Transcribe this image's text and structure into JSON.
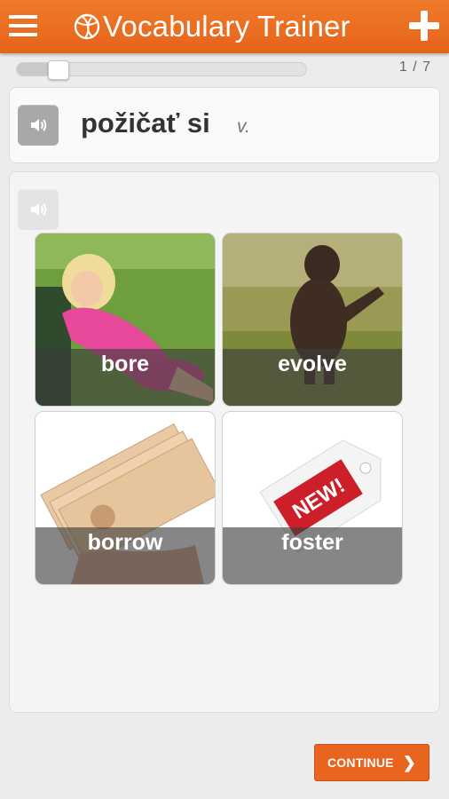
{
  "header": {
    "title": "Vocabulary Trainer",
    "menu_icon": "hamburger-menu-icon",
    "add_icon": "plus-icon",
    "logo_icon": "globe-logo-icon"
  },
  "progress": {
    "fraction": 0.14,
    "counter": "1 / 7"
  },
  "word": {
    "text": "požičať si",
    "part_of_speech": "v.",
    "sound_icon": "speaker-icon"
  },
  "choices": [
    {
      "label": "bore"
    },
    {
      "label": "evolve"
    },
    {
      "label": "borrow"
    },
    {
      "label": "foster"
    }
  ],
  "footer": {
    "continue_label": "CONTINUE",
    "continue_icon": "chevron-right-icon",
    "accent_color": "#e9641e"
  }
}
